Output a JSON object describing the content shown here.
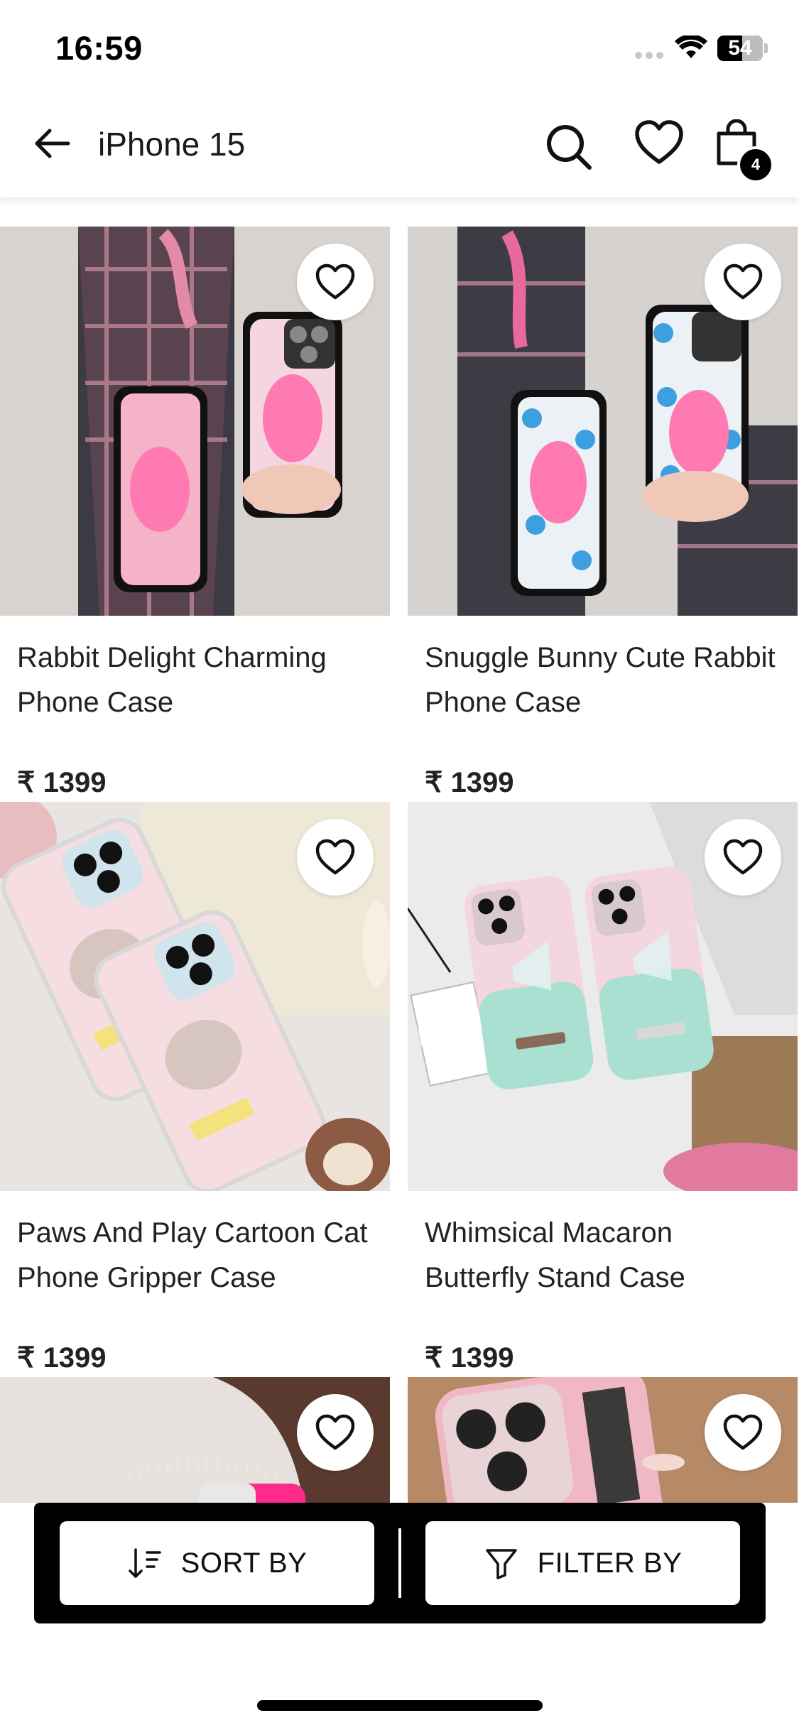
{
  "status_bar": {
    "time": "16:59",
    "battery": "54",
    "battery_level": 0.54
  },
  "header": {
    "title": "iPhone 15",
    "cart_count": "4"
  },
  "products": [
    {
      "name": "Rabbit Delight Charming Phone Case",
      "price": "₹ 1399"
    },
    {
      "name": "Snuggle Bunny Cute Rabbit Phone Case",
      "price": "₹ 1399"
    },
    {
      "name": "Paws And Play Cartoon Cat Phone Gripper Case",
      "price": "₹ 1399"
    },
    {
      "name": "Whimsical Macaron Butterfly Stand Case",
      "price": "₹ 1399"
    },
    {
      "name": "",
      "price": ""
    },
    {
      "name": "",
      "price": ""
    }
  ],
  "bottom_bar": {
    "sort_label": "SORT BY",
    "filter_label": "FILTER BY"
  },
  "colors": {
    "accent": "#000000",
    "background": "#ffffff",
    "text": "#1a1a1a"
  },
  "icons": [
    "back-arrow-icon",
    "search-icon",
    "heart-icon",
    "shopping-bag-icon",
    "sort-icon",
    "filter-icon"
  ]
}
